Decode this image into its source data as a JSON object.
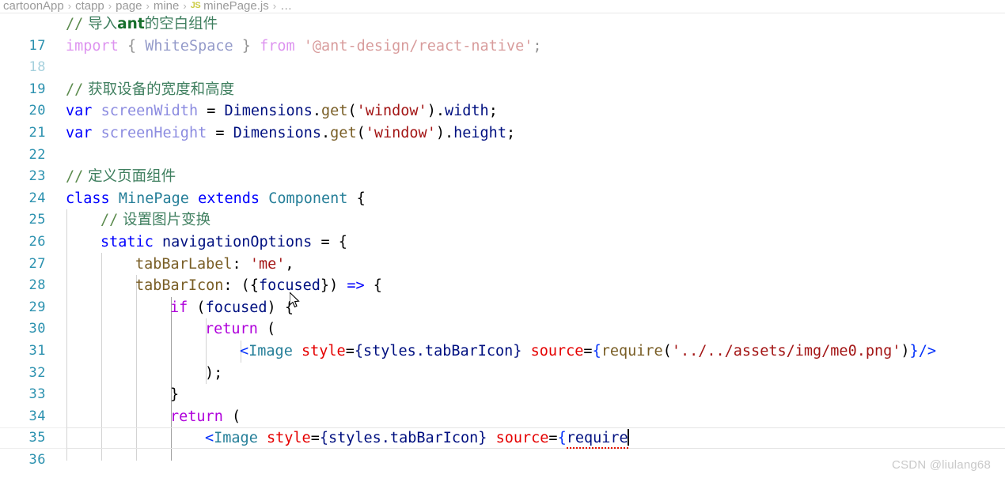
{
  "breadcrumb": {
    "items": [
      {
        "label": "cartoonApp",
        "icon": null
      },
      {
        "label": "ctapp",
        "icon": null
      },
      {
        "label": "page",
        "icon": null
      },
      {
        "label": "mine",
        "icon": null
      },
      {
        "label": "minePage.js",
        "icon": "js-file-icon"
      },
      {
        "label": "…",
        "icon": null
      }
    ],
    "separator": "›",
    "js_icon_text": "JS"
  },
  "editor": {
    "language": "javascript",
    "cursor_line": 36,
    "first_visible_line": 17,
    "last_visible_line": 36,
    "lines": [
      {
        "num": "17",
        "text": "// 导入ant的空白组件"
      },
      {
        "num": "18",
        "text": "import { WhiteSpace } from '@ant-design/react-native';"
      },
      {
        "num": "19",
        "text": ""
      },
      {
        "num": "20",
        "text": "// 获取设备的宽度和高度"
      },
      {
        "num": "21",
        "text": "var screenWidth = Dimensions.get('window').width;"
      },
      {
        "num": "22",
        "text": "var screenHeight = Dimensions.get('window').height;"
      },
      {
        "num": "23",
        "text": ""
      },
      {
        "num": "24",
        "text": "// 定义页面组件"
      },
      {
        "num": "25",
        "text": "class MinePage extends Component {"
      },
      {
        "num": "26",
        "text": "    // 设置图片变换"
      },
      {
        "num": "27",
        "text": "    static navigationOptions = {"
      },
      {
        "num": "28",
        "text": "        tabBarLabel: 'me',"
      },
      {
        "num": "29",
        "text": "        tabBarIcon: ({focused}) => {"
      },
      {
        "num": "30",
        "text": "            if (focused) {"
      },
      {
        "num": "31",
        "text": "                return ("
      },
      {
        "num": "32",
        "text": "                    <Image style={styles.tabBarIcon} source={require('../../assets/img/me0.png')}/>"
      },
      {
        "num": "33",
        "text": "                );"
      },
      {
        "num": "34",
        "text": "            }"
      },
      {
        "num": "35",
        "text": "            return ("
      },
      {
        "num": "36",
        "text": "                <Image style={styles.tabBarIcon} source={require"
      }
    ],
    "tokens": {
      "line17": {
        "slashes": "//",
        "pre": " 导入",
        "bold": "ant",
        "post": "的空白组件"
      },
      "line18": {
        "kw_import": "import",
        "brace_open": "{",
        "named": "WhiteSpace",
        "brace_close": "}",
        "kw_from": "from",
        "module": "'@ant-design/react-native'",
        "semi": ";"
      },
      "line20": {
        "slashes": "//",
        "text": " 获取设备的宽度和高度"
      },
      "line21": {
        "kw": "var",
        "name": "screenWidth",
        "eq": "=",
        "obj": "Dimensions",
        "dot1": ".",
        "method": "get",
        "paren_open": "(",
        "arg": "'window'",
        "paren_close": ")",
        "dot2": ".",
        "prop": "width",
        "semi": ";"
      },
      "line22": {
        "kw": "var",
        "name": "screenHeight",
        "eq": "=",
        "obj": "Dimensions",
        "dot1": ".",
        "method": "get",
        "paren_open": "(",
        "arg": "'window'",
        "paren_close": ")",
        "dot2": ".",
        "prop": "height",
        "semi": ";"
      },
      "line24": {
        "slashes": "//",
        "text": " 定义页面组件"
      },
      "line25": {
        "kw_class": "class",
        "name": "MinePage",
        "kw_extends": "extends",
        "base": "Component",
        "brace": "{"
      },
      "line26": {
        "slashes": "//",
        "text": " 设置图片变换"
      },
      "line27": {
        "kw": "static",
        "name": "navigationOptions",
        "eq": "=",
        "brace": "{"
      },
      "line28": {
        "prop": "tabBarLabel",
        "colon": ":",
        "value": "'me'",
        "comma": ","
      },
      "line29": {
        "prop": "tabBarIcon",
        "colon": ":",
        "paren": "(",
        "brace_open": "{",
        "param": "focused",
        "brace_close": "}",
        "paren_close": ")",
        "arrow": "=>",
        "body_brace": "{"
      },
      "line30": {
        "kw": "if",
        "paren_open": "(",
        "cond": "focused",
        "paren_close": ")",
        "brace": "{"
      },
      "line31": {
        "kw": "return",
        "paren": "("
      },
      "line32": {
        "lt": "<",
        "tag": "Image",
        "attr1": "style",
        "eq1": "=",
        "val1": "{styles.tabBarIcon}",
        "attr2": "source",
        "eq2": "=",
        "brace_open": "{",
        "func": "require",
        "paren_open": "(",
        "path": "'../../assets/img/me0.png'",
        "paren_close": ")",
        "brace_close": "}",
        "selfclose": "/>"
      },
      "line33": {
        "text": ");"
      },
      "line34": {
        "text": "}"
      },
      "line35": {
        "kw": "return",
        "paren": "("
      },
      "line36": {
        "lt": "<",
        "tag": "Image",
        "attr1": "style",
        "eq1": "=",
        "val1": "{styles.tabBarIcon}",
        "attr2": "source",
        "eq2": "=",
        "brace_open": "{",
        "ident": "require"
      }
    }
  },
  "watermark": {
    "text": "CSDN @liulang68"
  },
  "colors": {
    "comment": "#3f7f5f",
    "keyword": "#0000ff",
    "control_keyword": "#af00db",
    "identifier": "#001080",
    "class_name": "#267f99",
    "function": "#795e26",
    "string": "#a31515",
    "jsx_attribute": "#e50000",
    "brace_blue": "#0431fa",
    "line_number": "#2b91af",
    "background": "#ffffff",
    "watermark": "#c9c9c9"
  }
}
